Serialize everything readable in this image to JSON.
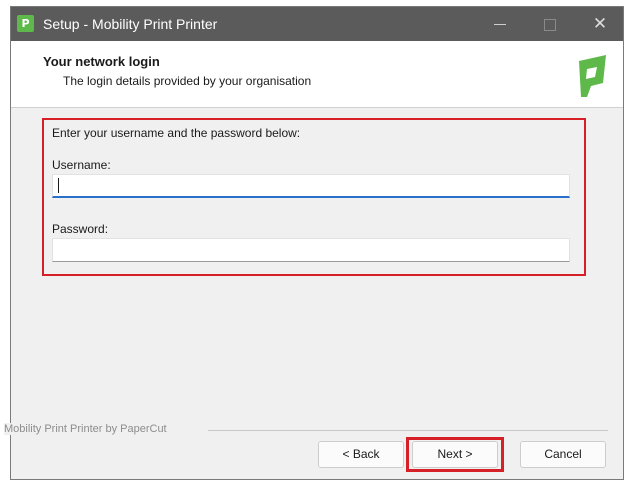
{
  "window": {
    "title": "Setup - Mobility Print Printer",
    "app_icon_letter": "P"
  },
  "header": {
    "title": "Your network login",
    "subtitle": "The login details provided by your organisation",
    "logo_icon": "papercut-logo-icon"
  },
  "form": {
    "instruction": "Enter your username and the password below:",
    "username_label": "Username:",
    "username_value": "",
    "password_label": "Password:",
    "password_value": ""
  },
  "footer": {
    "brand_text": "Mobility Print Printer by PaperCut",
    "back_label": "< Back",
    "next_label": "Next >",
    "cancel_label": "Cancel"
  },
  "colors": {
    "titlebar": "#5b5b5b",
    "highlight": "#d61f26",
    "focus_underline": "#2a6fc9",
    "logo_green": "#5fb84a"
  }
}
